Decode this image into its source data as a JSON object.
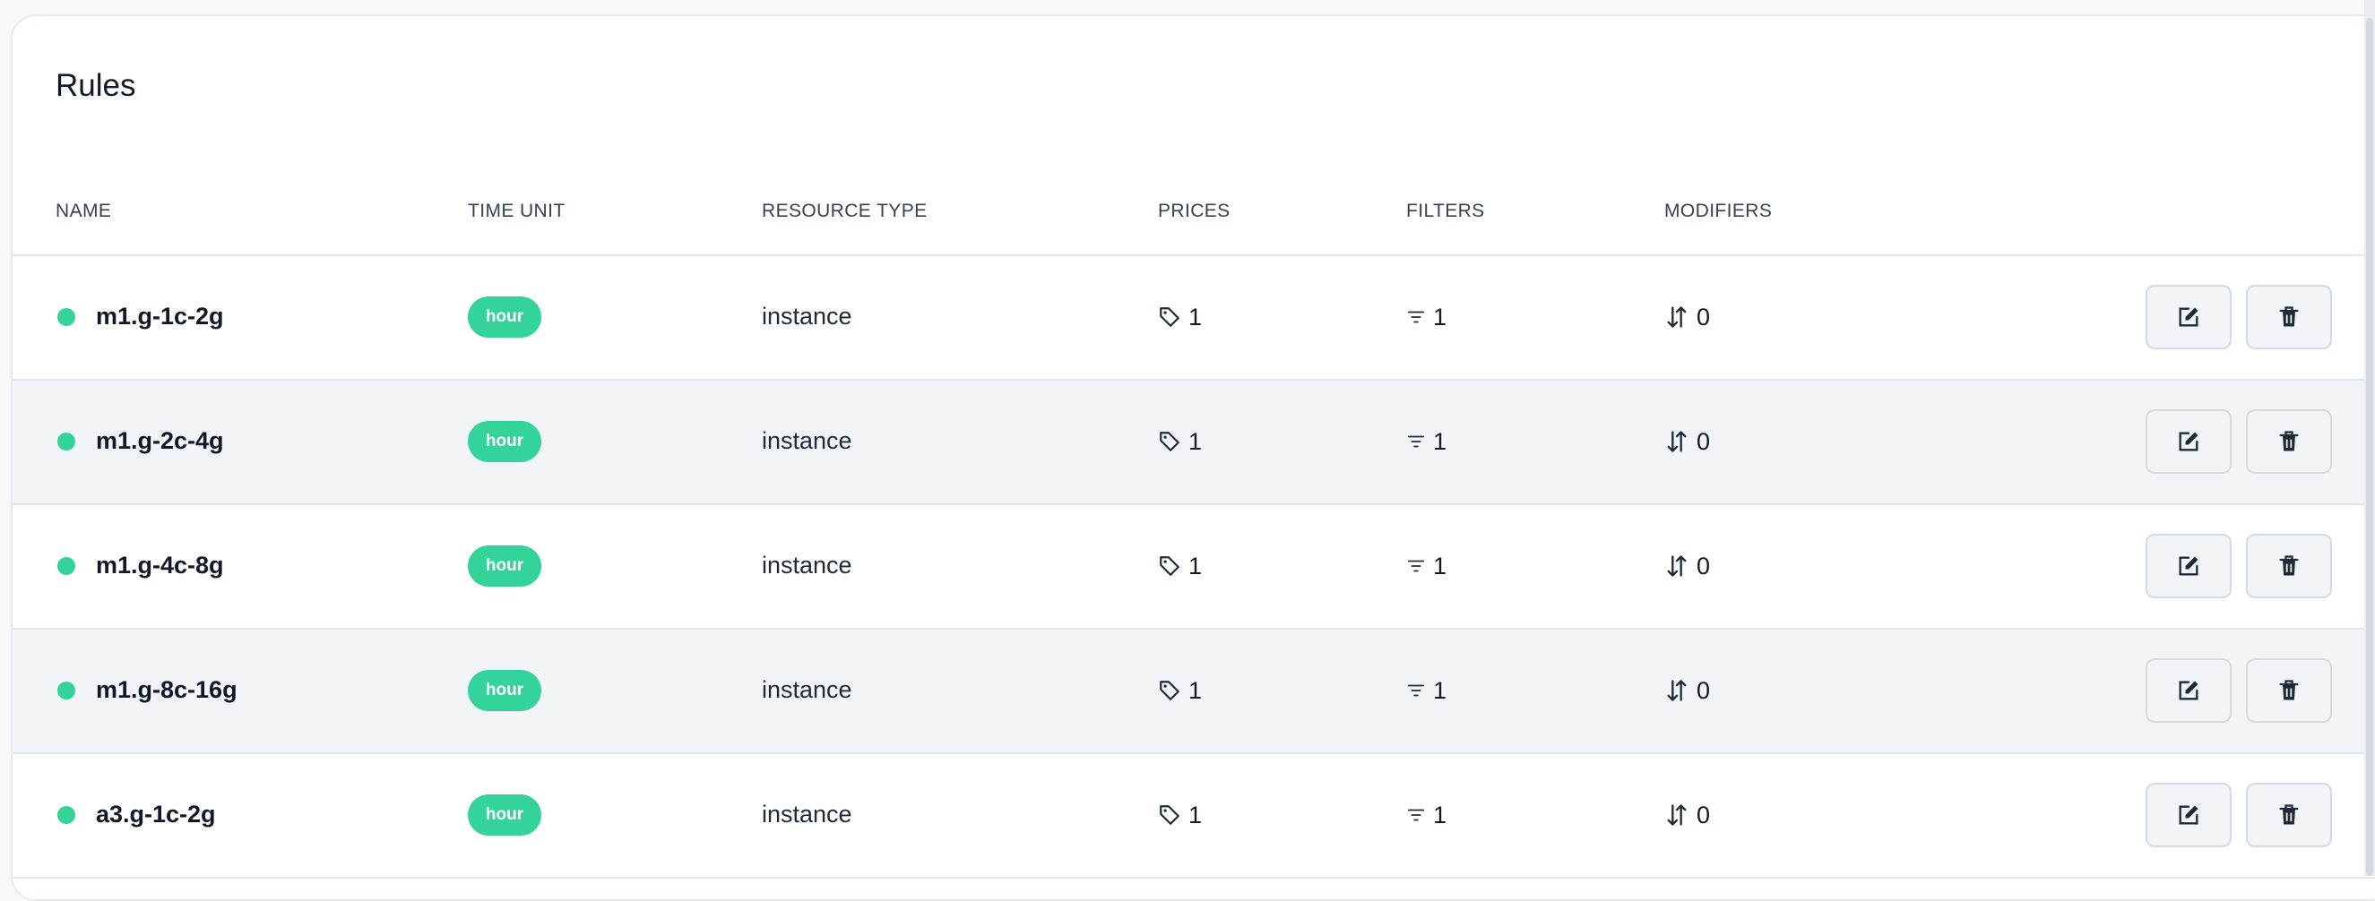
{
  "card": {
    "title": "Rules"
  },
  "table": {
    "columns": {
      "name": "NAME",
      "time_unit": "TIME UNIT",
      "resource_type": "RESOURCE TYPE",
      "prices": "PRICES",
      "filters": "FILTERS",
      "modifiers": "MODIFIERS"
    },
    "rows": [
      {
        "name": "m1.g-1c-2g",
        "time_unit": "hour",
        "resource_type": "instance",
        "prices": "1",
        "filters": "1",
        "modifiers": "0"
      },
      {
        "name": "m1.g-2c-4g",
        "time_unit": "hour",
        "resource_type": "instance",
        "prices": "1",
        "filters": "1",
        "modifiers": "0"
      },
      {
        "name": "m1.g-4c-8g",
        "time_unit": "hour",
        "resource_type": "instance",
        "prices": "1",
        "filters": "1",
        "modifiers": "0"
      },
      {
        "name": "m1.g-8c-16g",
        "time_unit": "hour",
        "resource_type": "instance",
        "prices": "1",
        "filters": "1",
        "modifiers": "0"
      },
      {
        "name": "a3.g-1c-2g",
        "time_unit": "hour",
        "resource_type": "instance",
        "prices": "1",
        "filters": "1",
        "modifiers": "0"
      }
    ]
  },
  "icons": {
    "status": "status-dot-icon",
    "prices": "tag-icon",
    "filters": "filter-icon",
    "modifiers": "sort-arrows-icon",
    "edit": "edit-icon",
    "delete": "trash-icon"
  },
  "colors": {
    "accent": "#34d399",
    "text": "#111827",
    "border": "#e3e7ec",
    "alt_row": "#f2f5f8"
  }
}
